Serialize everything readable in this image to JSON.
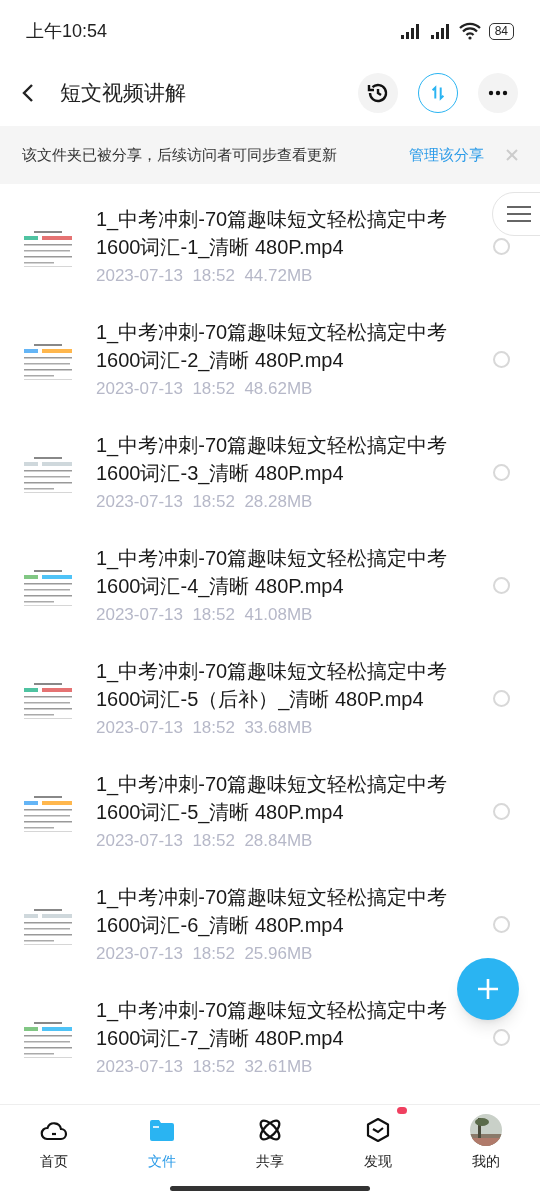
{
  "status_bar": {
    "time": "上午10:54",
    "battery": "84"
  },
  "header": {
    "title": "短文视频讲解"
  },
  "share_banner": {
    "text": "该文件夹已被分享，后续访问者可同步查看更新",
    "link": "管理该分享"
  },
  "files": [
    {
      "name": "1_中考冲刺-70篇趣味短文轻松搞定中考1600词汇-1_清晰 480P.mp4",
      "date": "2023-07-13",
      "time": "18:52",
      "size": "44.72MB",
      "selected": false
    },
    {
      "name": "1_中考冲刺-70篇趣味短文轻松搞定中考1600词汇-2_清晰 480P.mp4",
      "date": "2023-07-13",
      "time": "18:52",
      "size": "48.62MB",
      "selected": false
    },
    {
      "name": "1_中考冲刺-70篇趣味短文轻松搞定中考1600词汇-3_清晰 480P.mp4",
      "date": "2023-07-13",
      "time": "18:52",
      "size": "28.28MB",
      "selected": false
    },
    {
      "name": "1_中考冲刺-70篇趣味短文轻松搞定中考1600词汇-4_清晰 480P.mp4",
      "date": "2023-07-13",
      "time": "18:52",
      "size": "41.08MB",
      "selected": false
    },
    {
      "name": "1_中考冲刺-70篇趣味短文轻松搞定中考1600词汇-5（后补）_清晰 480P.mp4",
      "date": "2023-07-13",
      "time": "18:52",
      "size": "33.68MB",
      "selected": false
    },
    {
      "name": "1_中考冲刺-70篇趣味短文轻松搞定中考1600词汇-5_清晰 480P.mp4",
      "date": "2023-07-13",
      "time": "18:52",
      "size": "28.84MB",
      "selected": false
    },
    {
      "name": "1_中考冲刺-70篇趣味短文轻松搞定中考1600词汇-6_清晰 480P.mp4",
      "date": "2023-07-13",
      "time": "18:52",
      "size": "25.96MB",
      "selected": false
    },
    {
      "name": "1_中考冲刺-70篇趣味短文轻松搞定中考1600词汇-7_清晰 480P.mp4",
      "date": "2023-07-13",
      "time": "18:52",
      "size": "32.61MB",
      "selected": false
    }
  ],
  "bottom_nav": [
    {
      "kind": "cloud",
      "label": "首页",
      "selected": false,
      "badge": false
    },
    {
      "kind": "folder",
      "label": "文件",
      "selected": true,
      "badge": false
    },
    {
      "kind": "atom",
      "label": "共享",
      "selected": false,
      "badge": false
    },
    {
      "kind": "cube",
      "label": "发现",
      "selected": false,
      "badge": true
    },
    {
      "kind": "avatar",
      "label": "我的",
      "selected": false,
      "badge": false
    }
  ]
}
